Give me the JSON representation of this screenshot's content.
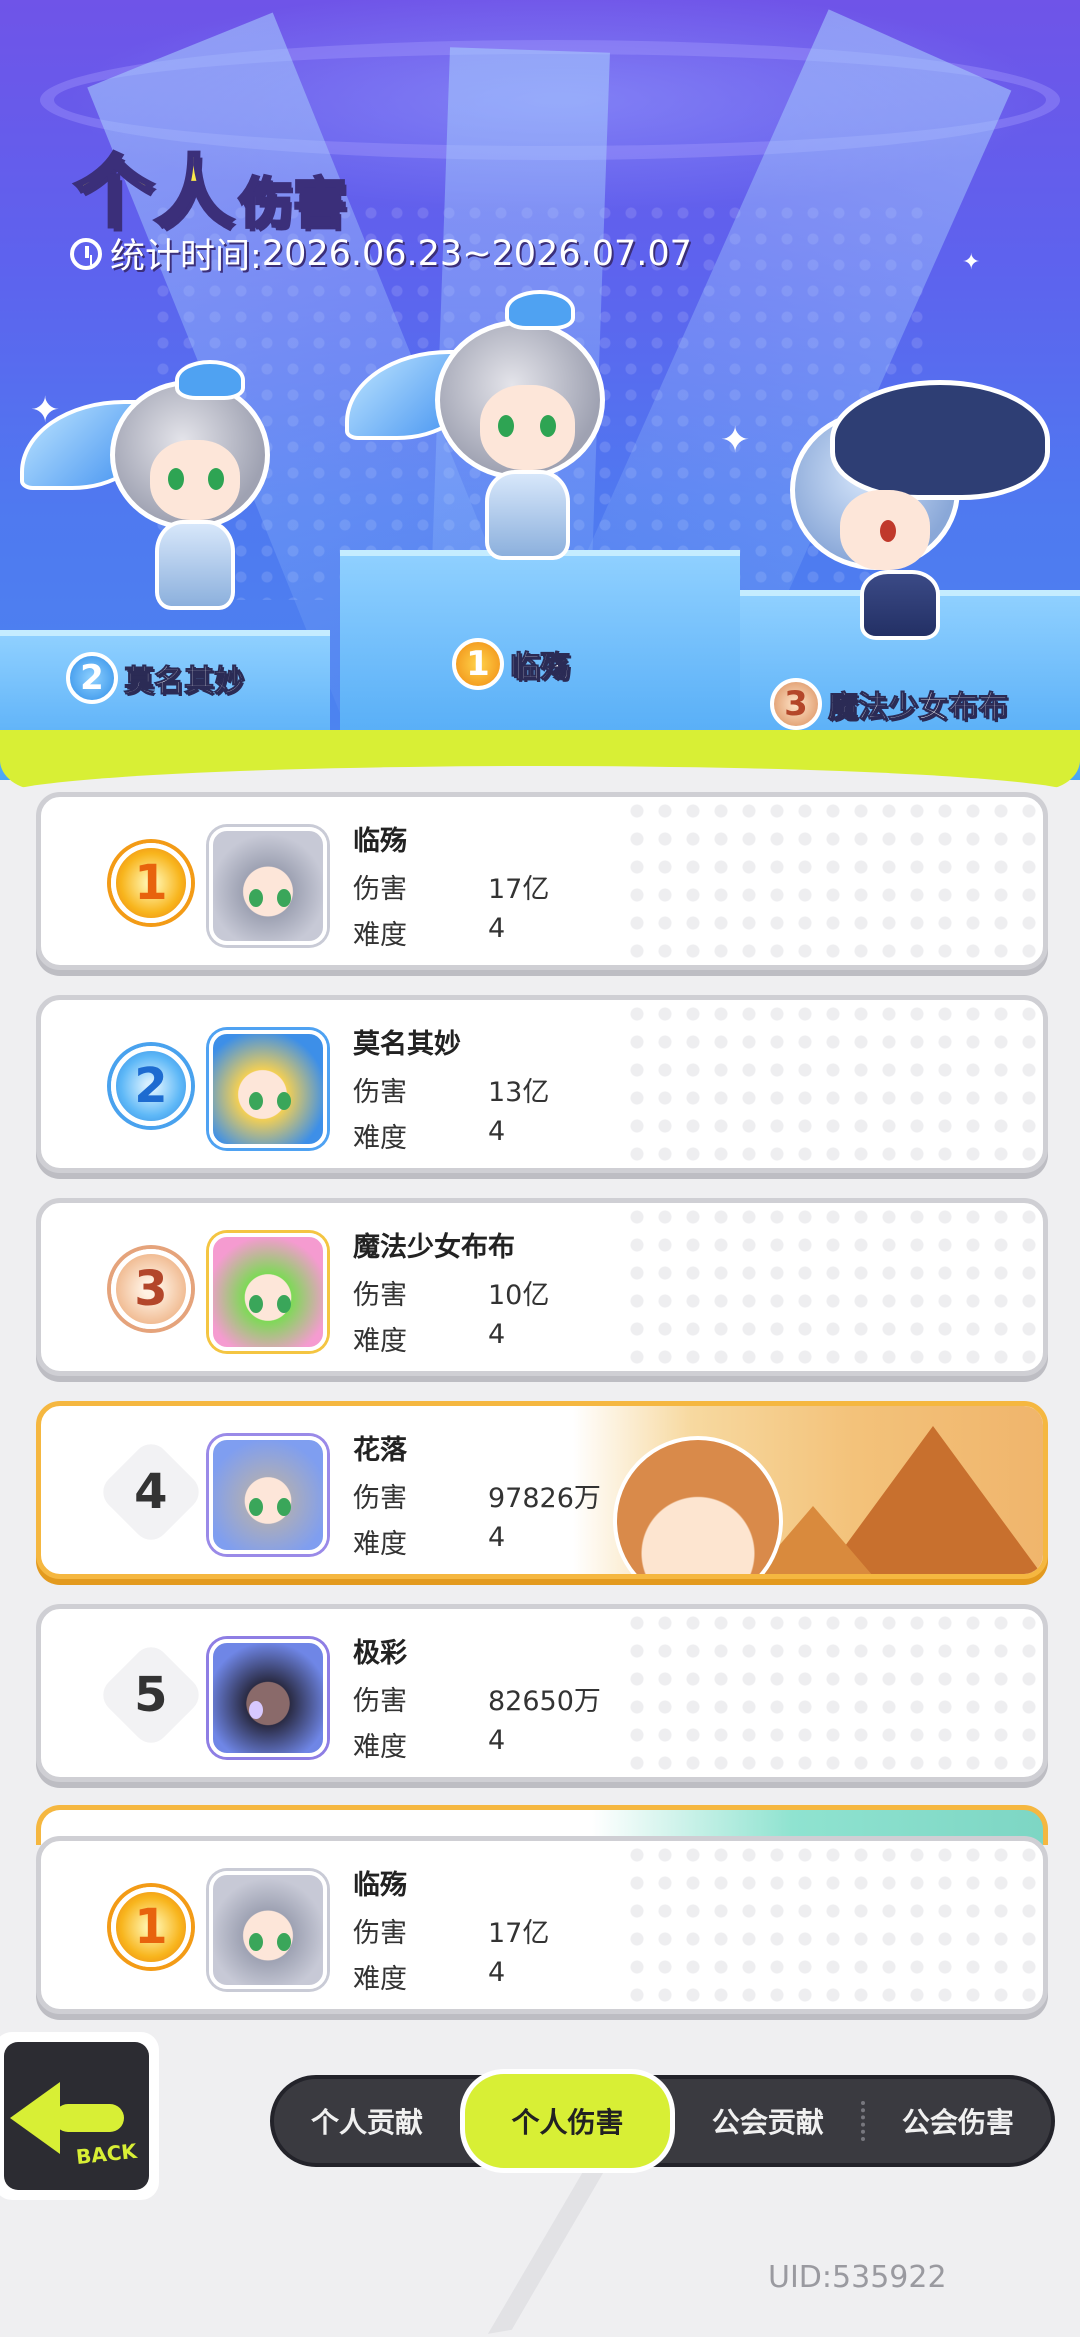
{
  "header": {
    "title_big": "个人",
    "title_small": "伤害",
    "period_label": "统计时间:",
    "period_value": "2026.06.23~2026.07.07"
  },
  "podium": [
    {
      "rank": "2",
      "name": "莫名其妙"
    },
    {
      "rank": "1",
      "name": "临殇"
    },
    {
      "rank": "3",
      "name": "魔法少女布布"
    }
  ],
  "labels": {
    "damage": "伤害",
    "difficulty": "难度"
  },
  "rankings": [
    {
      "rank": "1",
      "name": "临殇",
      "damage": "17亿",
      "difficulty": "4"
    },
    {
      "rank": "2",
      "name": "莫名其妙",
      "damage": "13亿",
      "difficulty": "4"
    },
    {
      "rank": "3",
      "name": "魔法少女布布",
      "damage": "10亿",
      "difficulty": "4"
    },
    {
      "rank": "4",
      "name": "花落",
      "damage": "97826万",
      "difficulty": "4"
    },
    {
      "rank": "5",
      "name": "极彩",
      "damage": "82650万",
      "difficulty": "4"
    }
  ],
  "my_rank": {
    "rank": "1",
    "name": "临殇",
    "damage": "17亿",
    "difficulty": "4"
  },
  "back_label": "BACK",
  "tabs": [
    "个人贡献",
    "个人伤害",
    "公会贡献",
    "公会伤害"
  ],
  "active_tab": "个人伤害",
  "uid": "UID:535922",
  "colors": {
    "accent": "#d8ef35",
    "stage_top": "#6f54e8",
    "stage_bottom": "#4b86f0",
    "highlight_border": "#f5b740"
  },
  "icons": {
    "period": "clock-icon",
    "back": "arrow-left-icon"
  }
}
